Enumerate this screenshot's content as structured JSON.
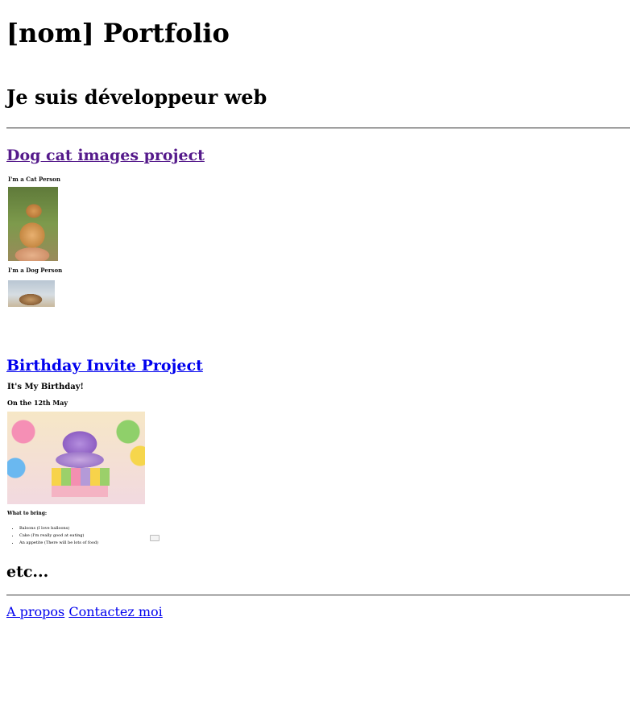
{
  "header": {
    "title": "[nom] Portfolio",
    "subtitle": "Je suis développeur web"
  },
  "projects": [
    {
      "title": "Dog cat images project",
      "thumbnail": {
        "caption_cat": "I'm a Cat Person",
        "caption_dog": "I'm a Dog Person"
      }
    },
    {
      "title": "Birthday Invite Project",
      "thumbnail": {
        "heading": "It's My Birthday!",
        "date": "On the 12th May",
        "bring_heading": "What to bring:",
        "bring_items": [
          "Baloons (I love balloons)",
          "Cake (I'm really good at eating)",
          "An appetite (There will be lots of food)"
        ]
      }
    }
  ],
  "etc": "etc...",
  "footer": {
    "links": [
      "A propos",
      "Contactez moi"
    ]
  },
  "colors": {
    "link": "#0000ee",
    "visited_link": "#551a8b"
  }
}
